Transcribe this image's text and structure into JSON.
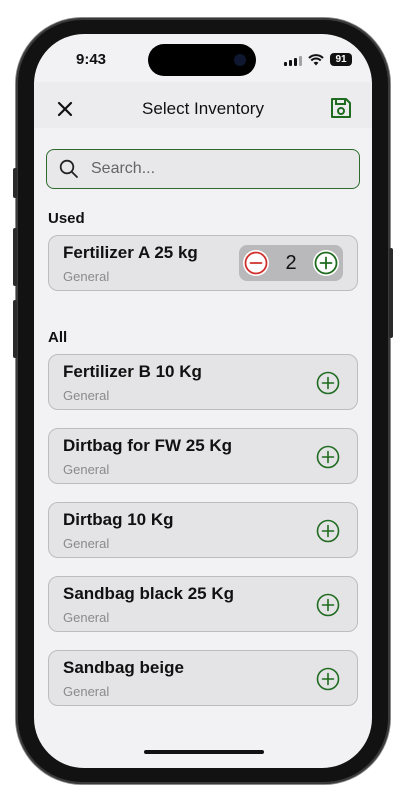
{
  "status": {
    "time": "9:43",
    "battery": "91"
  },
  "header": {
    "title": "Select Inventory"
  },
  "search": {
    "placeholder": "Search..."
  },
  "sections": {
    "used_label": "Used",
    "all_label": "All"
  },
  "used_items": [
    {
      "name": "Fertilizer A 25 kg",
      "category": "General",
      "quantity": "2"
    }
  ],
  "all_items": [
    {
      "name": "Fertilizer B 10 Kg",
      "category": "General"
    },
    {
      "name": "Dirtbag for FW 25 Kg",
      "category": "General"
    },
    {
      "name": "Dirtbag 10 Kg",
      "category": "General"
    },
    {
      "name": "Sandbag black 25 Kg",
      "category": "General"
    },
    {
      "name": "Sandbag beige",
      "category": "General"
    }
  ],
  "colors": {
    "accent": "#1f6b1f",
    "remove": "#d0312d",
    "background": "#f2f2f4"
  },
  "icons": {
    "close": "close-icon",
    "save": "save-icon",
    "search": "search-icon",
    "add": "plus-circle-icon",
    "remove": "minus-circle-icon"
  }
}
